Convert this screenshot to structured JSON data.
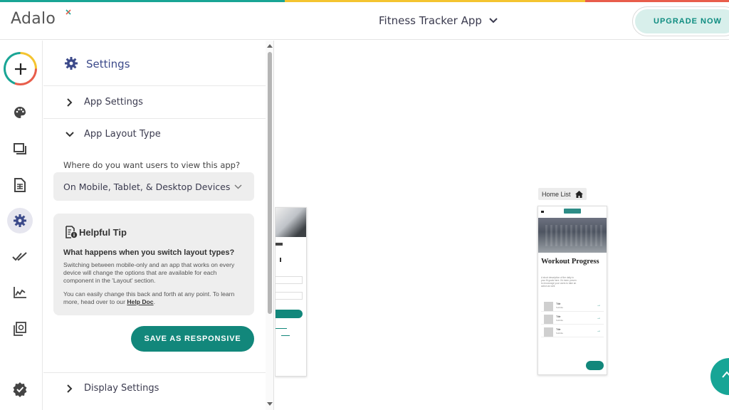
{
  "brand": {
    "logo_text": "Adalo",
    "accent_colors": [
      "#19a595",
      "#f4c430",
      "#e85d4b"
    ]
  },
  "header": {
    "app_name": "Fitness Tracker App",
    "upgrade_label": "UPGRADE NOW"
  },
  "rail": {
    "items": [
      {
        "name": "add",
        "icon": "plus-icon"
      },
      {
        "name": "branding",
        "icon": "palette-icon"
      },
      {
        "name": "screens",
        "icon": "screens-icon"
      },
      {
        "name": "database",
        "icon": "database-icon"
      },
      {
        "name": "settings",
        "icon": "gear-icon",
        "active": true
      },
      {
        "name": "publish",
        "icon": "double-check-icon"
      },
      {
        "name": "analytics",
        "icon": "analytics-icon"
      },
      {
        "name": "marketplace",
        "icon": "components-icon"
      },
      {
        "name": "checklist",
        "icon": "badge-check-icon"
      }
    ]
  },
  "settings": {
    "title": "Settings",
    "sections": {
      "app_settings": "App Settings",
      "app_layout_type": "App Layout Type",
      "display_settings": "Display Settings"
    },
    "layout_question": "Where do you want users to view this app?",
    "layout_value": "On Mobile, Tablet, & Desktop Devices",
    "tip": {
      "title": "Helpful Tip",
      "question": "What happens when you switch layout types?",
      "para1": "Switching between mobile-only and an app that works on every device will change the options that are available for each component in the 'Layout' section.",
      "para2_prefix": "You can easily change this back and forth at any point. To learn more, head over to our",
      "link": "Help Doc",
      "para2_suffix": "."
    },
    "save_label": "SAVE AS RESPONSIVE"
  },
  "canvas": {
    "screen_label": "Home List",
    "preview": {
      "title": "Workout Progress",
      "description": "A short description of the daily in your fit goals here. It's been proven to encourage your users to take an action as well.",
      "list_items": [
        {
          "title": "Title",
          "subtitle": "Subtitle"
        },
        {
          "title": "Title",
          "subtitle": "Subtitle"
        },
        {
          "title": "Title",
          "subtitle": "Subtitle"
        }
      ]
    }
  }
}
